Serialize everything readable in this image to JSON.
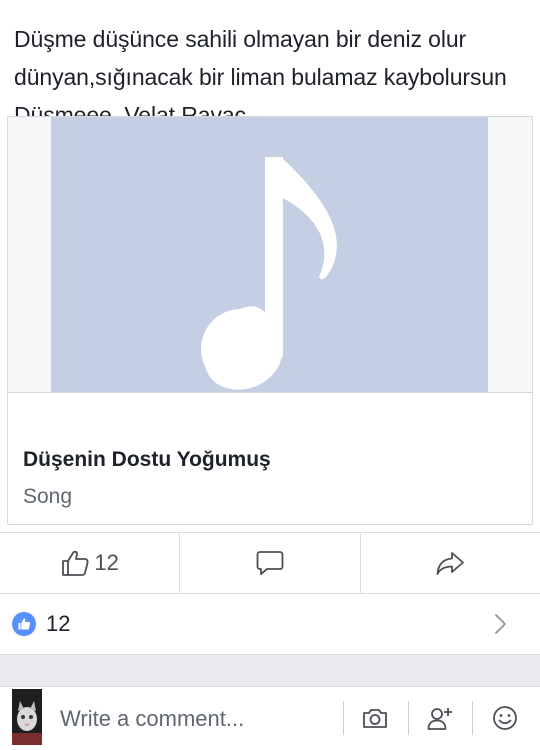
{
  "post": {
    "text": "Düşme düşünce sahili olmayan bir deniz olur dünyan,sığınacak bir liman bulamaz kaybolursun Düşmeee..Velat Ravac"
  },
  "attachment": {
    "title": "Düşenin Dostu Yoğumuş",
    "subtitle": "Song",
    "icon": "music-note-icon",
    "art_color": "#c5cfe3"
  },
  "actions": {
    "like_count": "12",
    "like_icon": "thumbs-up-icon",
    "comment_icon": "comment-icon",
    "share_icon": "share-icon"
  },
  "reactions": {
    "count": "12",
    "badge_color": "#5890ff"
  },
  "composer": {
    "placeholder": "Write a comment...",
    "icons": [
      "camera-icon",
      "tag-friends-icon",
      "emoji-icon"
    ]
  }
}
